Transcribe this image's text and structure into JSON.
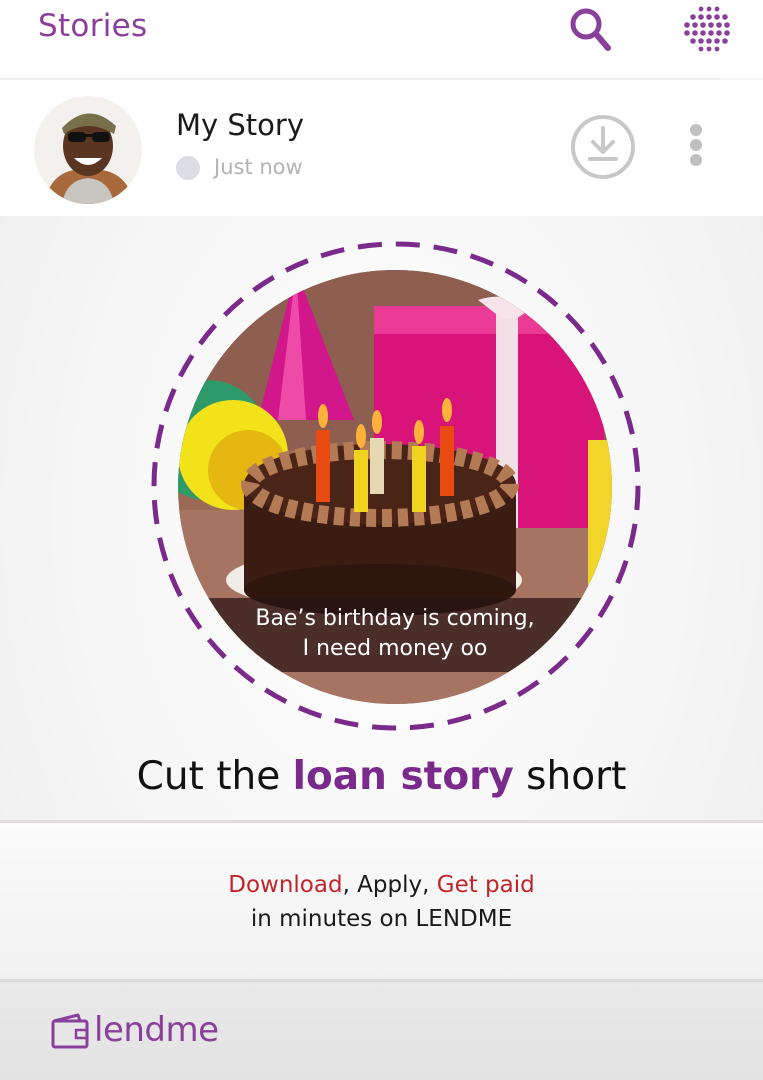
{
  "header": {
    "title": "Stories",
    "search_icon": "search-icon",
    "menu_icon": "dot-grid-icon",
    "accent_color": "#8a3f9b"
  },
  "story": {
    "name": "My Story",
    "time": "Just now",
    "download_icon": "download-circle-icon",
    "more_icon": "vertical-dots-icon"
  },
  "ad": {
    "caption_line1": "Bae’s birthday is coming,",
    "caption_line2": "I need money oo",
    "headline_pre": "Cut the ",
    "headline_highlight": "loan story",
    "headline_post": " short",
    "promo_download": "Download",
    "promo_apply": ", Apply, ",
    "promo_getpaid": "Get paid",
    "promo_line2": "in minutes on LENDME",
    "brand": "lendme",
    "brand_color": "#8a3f9b",
    "highlight_red": "#c2262b"
  }
}
